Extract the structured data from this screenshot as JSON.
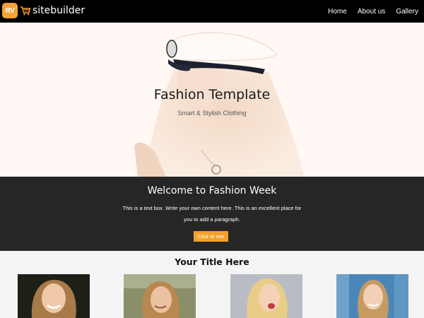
{
  "nav": {
    "logo_badge": "RV",
    "logo_text": "sitebuilder",
    "links": [
      {
        "label": "Home"
      },
      {
        "label": "About us"
      },
      {
        "label": "Gallery"
      }
    ]
  },
  "hero": {
    "title": "Fashion Template",
    "subtitle": "Smart & Stylish Clothing"
  },
  "welcome": {
    "heading": "Welcome to Fashion Week",
    "paragraph": "This is a text box. Write your own content here. This is an excellent place for you to add a paragraph.",
    "button_label": "Click to see"
  },
  "gallery": {
    "title": "Your Title Here",
    "items": [
      {
        "icon": "portrait-photo"
      },
      {
        "icon": "portrait-photo"
      },
      {
        "icon": "portrait-photo"
      },
      {
        "icon": "portrait-photo"
      }
    ]
  },
  "colors": {
    "accent": "#f2a127",
    "nav_bg": "#000000",
    "band_bg": "#262626",
    "page_bg": "#f4f4f4"
  }
}
